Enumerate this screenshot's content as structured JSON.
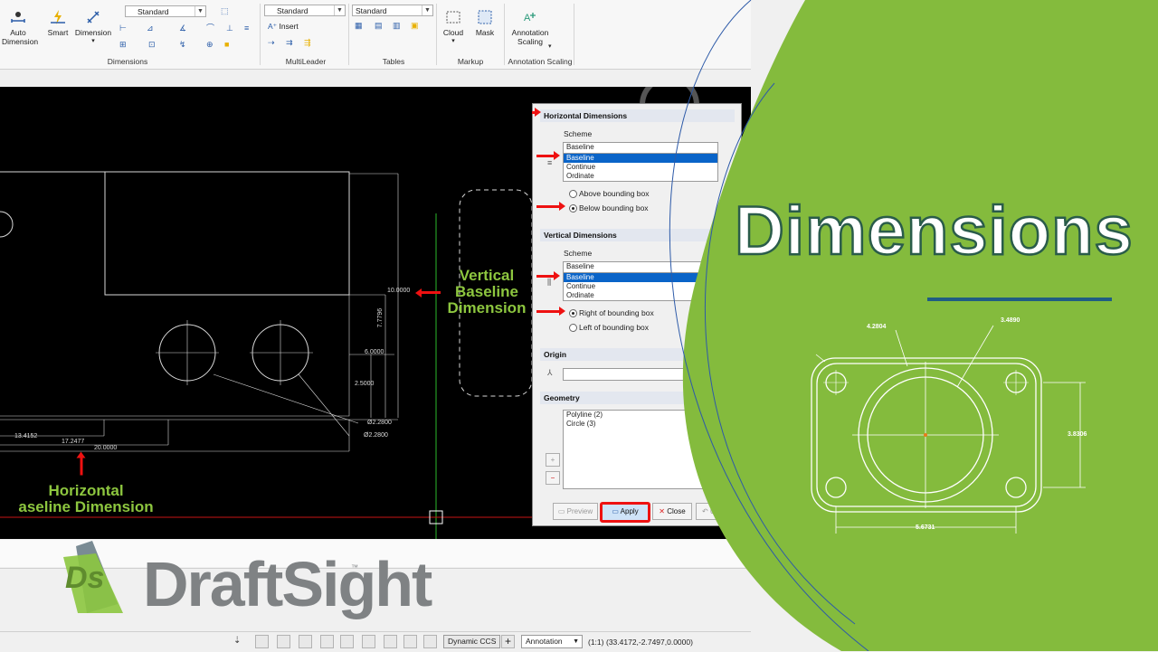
{
  "ribbon": {
    "groups": {
      "dimensions": "Dimensions",
      "multileader": "MultiLeader",
      "tables": "Tables",
      "markup": "Markup",
      "annotation_scaling": "Annotation Scaling"
    },
    "buttons": {
      "auto_dimension": "Auto\nDimension",
      "smart": "Smart",
      "dimension": "Dimension",
      "cloud": "Cloud",
      "mask": "Mask",
      "annotation_scaling": "Annotation\nScaling",
      "insert": "Insert"
    },
    "combos": {
      "dim_style": "Standard",
      "mleader_style": "Standard",
      "table_style": "Standard"
    }
  },
  "drawing": {
    "dims": {
      "v_10": "10.0000",
      "v_7": "7.7796",
      "v_6": "6.0000",
      "v_25": "2.5000",
      "d1": "Ø2.2800",
      "d2": "Ø2.2800",
      "h_13": "13.4152",
      "h_17": "17.2477",
      "h_20": "20.0000"
    },
    "annotations": {
      "vertical": "Vertical\nBaseline\nDimension",
      "horizontal": "Horizontal\naseline Dimension"
    }
  },
  "dialog": {
    "horizontal": {
      "title": "Horizontal Dimensions",
      "scheme_label": "Scheme",
      "scheme_value": "Baseline",
      "options": [
        "Baseline",
        "Continue",
        "Ordinate"
      ],
      "selected": "Baseline",
      "placement_above": "Above bounding box",
      "placement_below": "Below bounding box",
      "placement_selected": "below"
    },
    "vertical": {
      "title": "Vertical Dimensions",
      "scheme_label": "Scheme",
      "scheme_value": "Baseline",
      "options": [
        "Baseline",
        "Continue",
        "Ordinate"
      ],
      "selected": "Baseline",
      "placement_right": "Right of bounding box",
      "placement_left": "Left of bounding box",
      "placement_selected": "right"
    },
    "origin_title": "Origin",
    "geometry_title": "Geometry",
    "geometry_items": [
      "Polyline (2)",
      "Circle (3)"
    ],
    "buttons": {
      "preview": "Preview",
      "apply": "Apply",
      "close": "Close",
      "undo": "Undo"
    }
  },
  "status": {
    "ccs": "Dynamic CCS",
    "annotation": "Annotation",
    "scale": "(1:1)",
    "coords": "(33.4172,-2.7497,0.0000)"
  },
  "logo": {
    "mark": "Ds",
    "text": "DraftSight",
    "tm": "™"
  },
  "panel": {
    "title": "Dimensions",
    "dims": {
      "a": "4.2804",
      "b": "3.4890",
      "c": "3.8306",
      "d": "5.6731"
    }
  },
  "colors": {
    "panel_green": "#84bb3d",
    "annotation_green": "#8dc63f",
    "arrow_red": "#e11111",
    "selection_blue": "#0a64c8",
    "title_rule": "#1f5d83"
  }
}
